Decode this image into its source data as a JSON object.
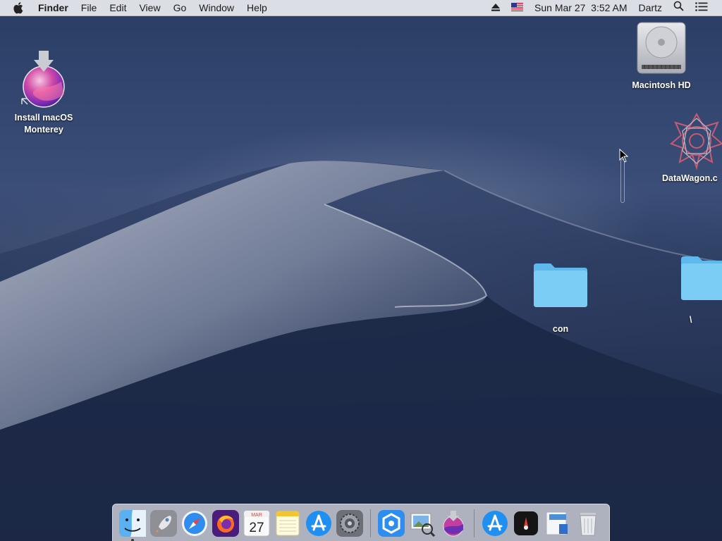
{
  "menubar": {
    "app_name": "Finder",
    "menus": [
      "File",
      "Edit",
      "View",
      "Go",
      "Window",
      "Help"
    ],
    "status": {
      "datetime": "Sun Mar 27  3:52 AM",
      "user": "Dartz"
    }
  },
  "desktop": {
    "icons": {
      "installer": "Install macOS Monterey",
      "installer_line1": "Install macOS",
      "installer_line2": "Monterey",
      "hd": "Macintosh HD",
      "datawagon": "DataWagon.c",
      "folder_con": "con",
      "folder_backslash": "\\"
    }
  },
  "dock": {
    "calendar_month": "MAR",
    "calendar_day": "27",
    "apps": [
      "Finder",
      "Launchpad",
      "Safari",
      "Firefox",
      "Calendar",
      "Notes",
      "App Store",
      "System Preferences",
      "Proxyman",
      "Preview",
      "Install macOS Monterey",
      "App Store",
      "Instruments",
      "Documents",
      "Trash"
    ]
  },
  "colors": {
    "folder": "#6cc3f3",
    "menubar_bg": "#ececf0",
    "dock_bg": "#d7dae1"
  }
}
